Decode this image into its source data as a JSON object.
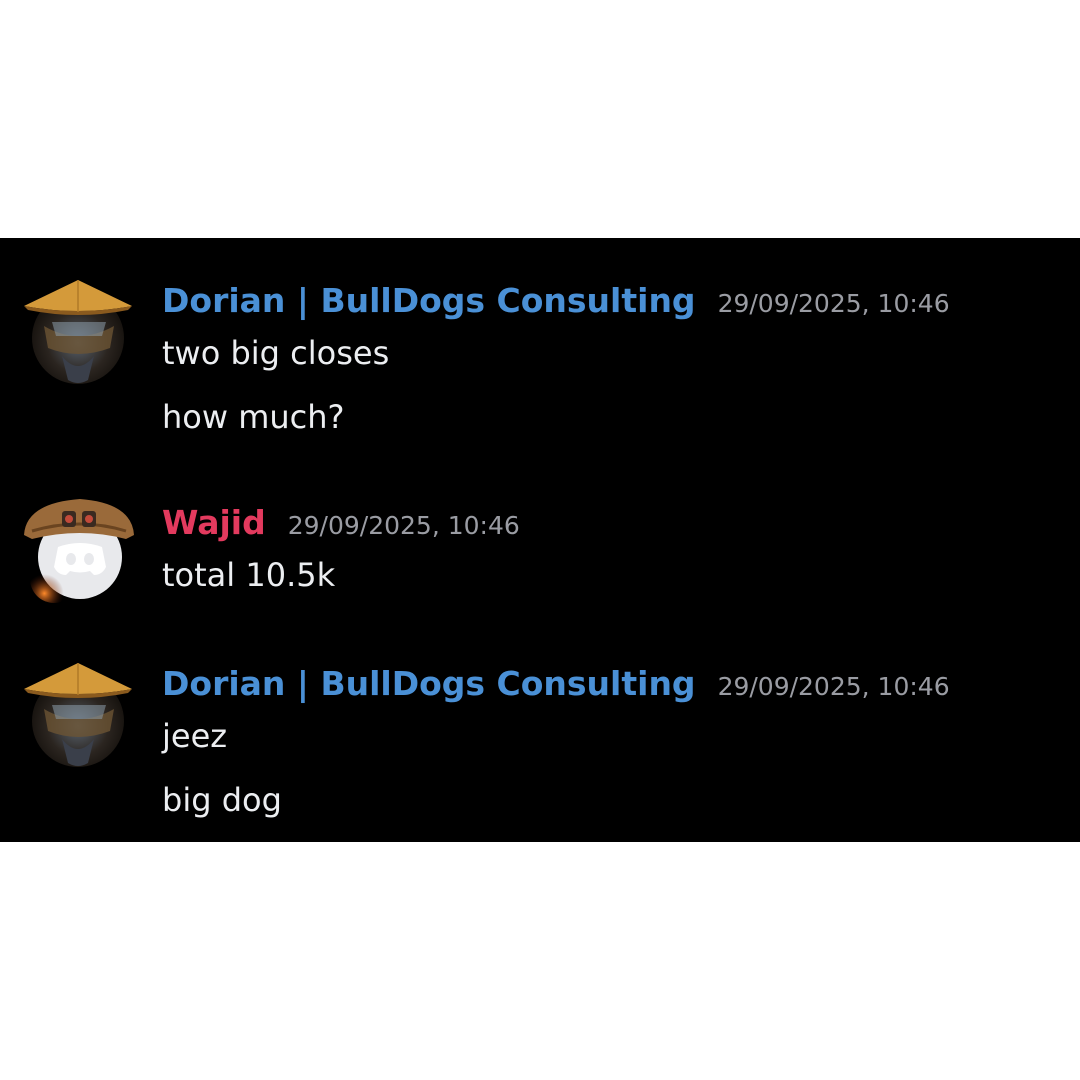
{
  "colors": {
    "chat_background": "#000000",
    "page_background": "#ffffff",
    "timestamp": "#9a9ca3",
    "message_text": "#eceef1"
  },
  "messages": [
    {
      "username": "Dorian | BullDogs Consulting",
      "username_color": "#4a90d6",
      "timestamp": "29/09/2025, 10:46",
      "avatar_icon": "straw-hat-avatar",
      "lines": [
        "two big closes",
        "how much?"
      ]
    },
    {
      "username": "Wajid",
      "username_color": "#e33a5e",
      "timestamp": "29/09/2025, 10:46",
      "avatar_icon": "discord-logo-avatar",
      "lines": [
        "total 10.5k"
      ]
    },
    {
      "username": "Dorian | BullDogs Consulting",
      "username_color": "#4a90d6",
      "timestamp": "29/09/2025, 10:46",
      "avatar_icon": "straw-hat-avatar",
      "lines": [
        "jeez",
        "big dog"
      ]
    }
  ]
}
